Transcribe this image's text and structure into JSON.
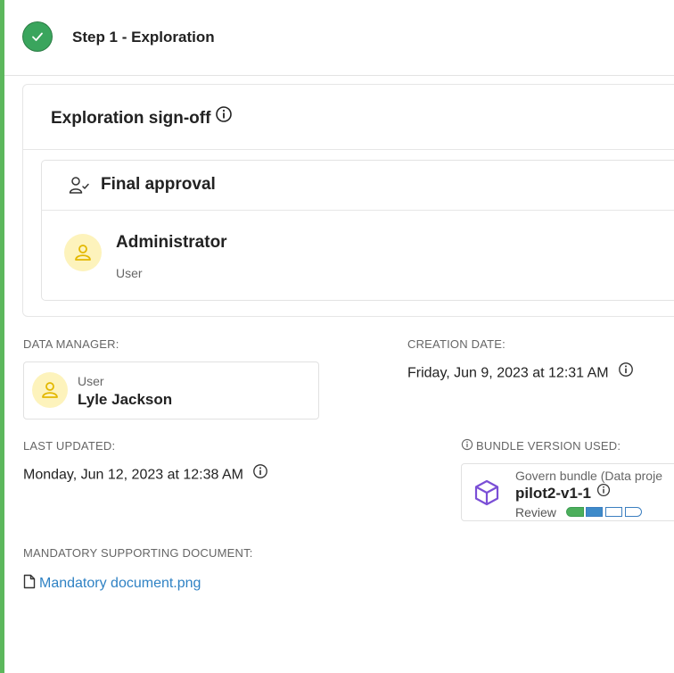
{
  "step": {
    "title": "Step 1 - Exploration",
    "status_color": "#3aa55d"
  },
  "signoff": {
    "title": "Exploration sign-off",
    "approval": {
      "title": "Final approval",
      "approver": {
        "name": "Administrator",
        "role": "User"
      }
    }
  },
  "details": {
    "data_manager": {
      "label": "DATA MANAGER:",
      "role": "User",
      "name": "Lyle Jackson"
    },
    "creation_date": {
      "label": "CREATION DATE:",
      "value": "Friday, Jun 9, 2023 at 12:31 AM"
    },
    "last_updated": {
      "label": "LAST UPDATED:",
      "value": "Monday, Jun 12, 2023 at 12:38 AM"
    },
    "bundle": {
      "label": "BUNDLE VERSION USED:",
      "type": "Govern bundle (Data proje",
      "name": "pilot2-v1-1",
      "status": "Review",
      "progress": {
        "completed_steps": 2,
        "total_steps": 4
      }
    },
    "document": {
      "label": "MANDATORY SUPPORTING DOCUMENT:",
      "filename": "Mandatory document.png"
    }
  },
  "colors": {
    "accent_green": "#5cb85c",
    "link_blue": "#2f82c4",
    "bundle_purple": "#7b4fd6",
    "avatar_bg": "#fdf3bc",
    "avatar_fg": "#e3b800"
  },
  "icons": [
    "check-icon",
    "info-icon",
    "user-check-icon",
    "user-icon",
    "cube-icon",
    "file-icon"
  ]
}
